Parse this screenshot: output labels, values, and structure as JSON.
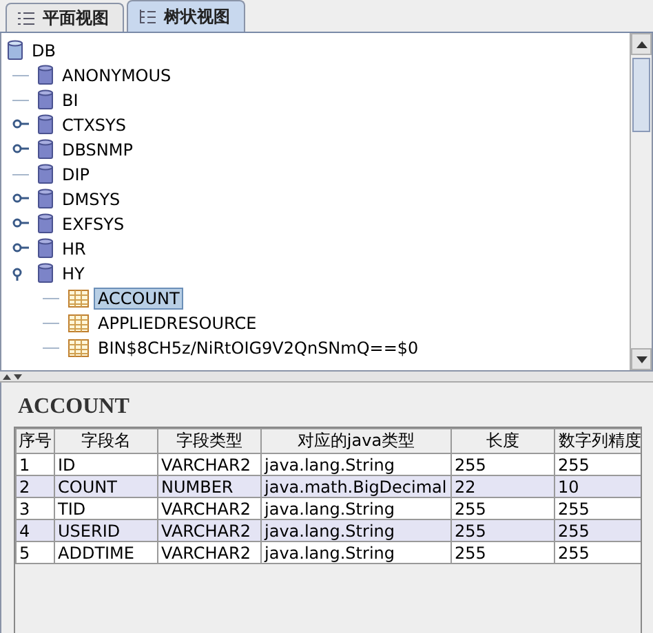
{
  "tabs": [
    {
      "label": "平面视图",
      "selected": false
    },
    {
      "label": "树状视图",
      "selected": true
    }
  ],
  "tree": {
    "label": "DB",
    "children": [
      {
        "label": "ANONYMOUS",
        "kind": "schema"
      },
      {
        "label": "BI",
        "kind": "schema"
      },
      {
        "label": "CTXSYS",
        "kind": "schema",
        "expanded": false
      },
      {
        "label": "DBSNMP",
        "kind": "schema",
        "expanded": false
      },
      {
        "label": "DIP",
        "kind": "schema"
      },
      {
        "label": "DMSYS",
        "kind": "schema",
        "expanded": false
      },
      {
        "label": "EXFSYS",
        "kind": "schema",
        "expanded": false
      },
      {
        "label": "HR",
        "kind": "schema",
        "expanded": false
      },
      {
        "label": "HY",
        "kind": "schema",
        "expanded": true,
        "children": [
          {
            "label": "ACCOUNT",
            "kind": "table",
            "selected": true
          },
          {
            "label": "APPLIEDRESOURCE",
            "kind": "table",
            "selected": false
          },
          {
            "label": "BIN$8CH5z/NiRtOIG9V2QnSNmQ==$0",
            "kind": "table",
            "selected": false
          }
        ]
      }
    ]
  },
  "detail": {
    "title": "ACCOUNT",
    "table": {
      "columns": [
        "序号",
        "字段名",
        "字段类型",
        "对应的java类型",
        "长度",
        "数字列精度"
      ],
      "rows": [
        [
          "1",
          "ID",
          "VARCHAR2",
          "java.lang.String",
          "255",
          "255"
        ],
        [
          "2",
          "COUNT",
          "NUMBER",
          "java.math.BigDecimal",
          "22",
          "10"
        ],
        [
          "3",
          "TID",
          "VARCHAR2",
          "java.lang.String",
          "255",
          "255"
        ],
        [
          "4",
          "USERID",
          "VARCHAR2",
          "java.lang.String",
          "255",
          "255"
        ],
        [
          "5",
          "ADDTIME",
          "VARCHAR2",
          "java.lang.String",
          "255",
          "255"
        ]
      ]
    }
  }
}
